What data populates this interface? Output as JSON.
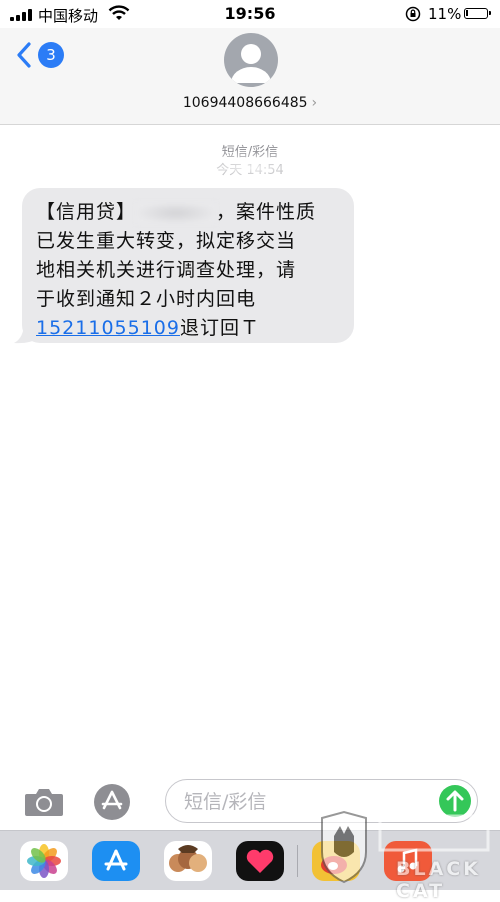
{
  "status_bar": {
    "carrier": "中国移动",
    "time": "19:56",
    "battery_percent": "11%",
    "battery_level": 0.11,
    "icons": [
      "signal-icon",
      "wifi-icon",
      "orientation-lock-icon",
      "battery-icon"
    ]
  },
  "header": {
    "back_badge": "3",
    "contact_number": "10694408666485",
    "contact_chevron": "›"
  },
  "conversation": {
    "timestamp_label": "短信/彩信",
    "timestamp_time": "今天 14:54",
    "message": {
      "lines": [
        "【信用贷】",
        "，案件性质",
        "已发生重大转变，拟定移交当",
        "地相关机关进行调查处理，请",
        "于收到通知２小时内回电"
      ],
      "phone_link": "15211055109",
      "suffix": "退订回Ｔ"
    }
  },
  "input_bar": {
    "placeholder": "短信/彩信"
  },
  "app_drawer": {
    "apps": [
      "photos-app-icon",
      "app-store-icon",
      "memoji-icon",
      "digital-touch-icon",
      "weibo-icon",
      "music-app-icon"
    ]
  },
  "watermark": {
    "text": "BLACK CAT"
  },
  "colors": {
    "accent": "#2b7cf6",
    "link": "#1a6ee8",
    "send": "#34c759",
    "bubble": "#e9e9eb"
  }
}
